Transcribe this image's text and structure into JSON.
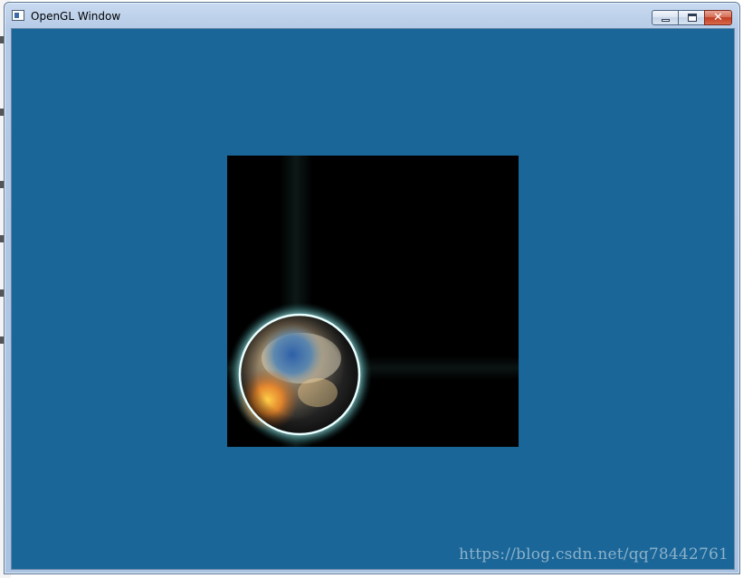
{
  "window": {
    "title": "OpenGL Window",
    "app_icon": "app-window-icon",
    "buttons": {
      "minimize_icon": "minimize-icon",
      "maximize_icon": "maximize-icon",
      "close_icon": "close-icon",
      "close_glyph": "✕"
    }
  },
  "scene": {
    "clear_color": "#1a6698",
    "viewport_color": "#000000",
    "glow_color": "#bff3f3",
    "object": "textured-sphere"
  },
  "watermark": "https://blog.csdn.net/qq78442761"
}
